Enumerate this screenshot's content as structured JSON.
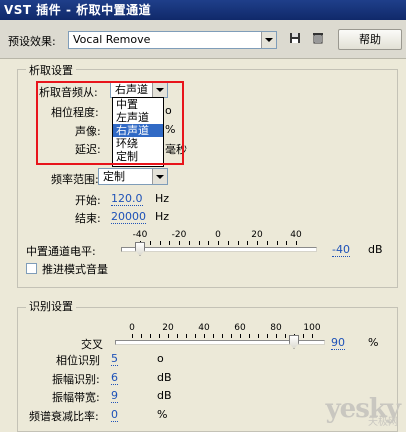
{
  "window": {
    "title": "VST 插件 - 析取中置通道"
  },
  "toolbar": {
    "preset_label": "预设效果:",
    "preset_value": "Vocal Remove",
    "help_label": "帮助",
    "save_icon": "save-icon",
    "delete_icon": "delete-icon"
  },
  "extract": {
    "title": "析取设置",
    "source_label": "析取音频从:",
    "source_value": "右声道",
    "source_options": [
      "中置",
      "左声道",
      "右声道",
      "环绕",
      "定制"
    ],
    "source_selected_index": 2,
    "phase_label": "相位程度:",
    "phase_unit": "o",
    "pan_label": "声像:",
    "pan_unit": "%",
    "delay_label": "延迟:",
    "delay_unit": "毫秒",
    "freq_label": "频率范围:",
    "freq_value": "定制",
    "start_label": "开始:",
    "start_value": "120.0",
    "start_unit": "Hz",
    "end_label": "结束:",
    "end_value": "20000",
    "end_unit": "Hz",
    "center_level_label": "中置通道电平:",
    "center_level_ticks": [
      "-40",
      "-20",
      "0",
      "20",
      "40"
    ],
    "center_level_value": "-40",
    "center_level_unit": "dB",
    "center_level_fraction": 0.0,
    "boost_label": "推进模式音量"
  },
  "detect": {
    "title": "识别设置",
    "crossover_label": "交叉",
    "crossover_ticks": [
      "0",
      "20",
      "40",
      "60",
      "80",
      "100"
    ],
    "crossover_value": "90",
    "crossover_unit": "%",
    "crossover_fraction": 0.9,
    "phase_detect_label": "相位识别",
    "phase_detect_value": "5",
    "phase_detect_unit": "o",
    "amp_detect_label": "振幅识别:",
    "amp_detect_value": "6",
    "amp_detect_unit": "dB",
    "amp_bw_label": "振幅带宽:",
    "amp_bw_value": "9",
    "amp_bw_unit": "dB",
    "decay_label": "频谱衰减比率:",
    "decay_value": "0",
    "decay_unit": "%"
  },
  "watermark": {
    "brand": "yesky",
    "sub": "天极网"
  },
  "colors": {
    "highlight": "#316ac5",
    "annotation": "#e8141b",
    "link": "#1e52b8"
  }
}
